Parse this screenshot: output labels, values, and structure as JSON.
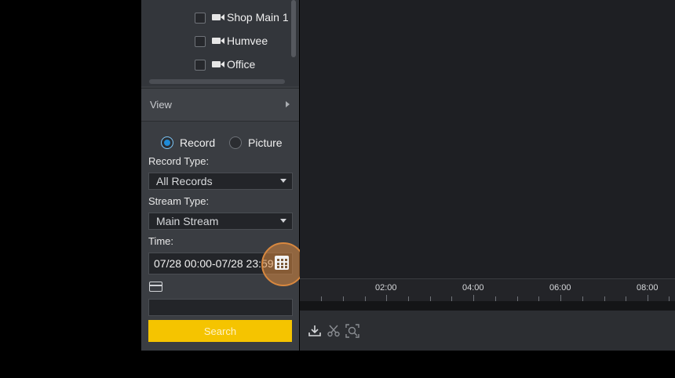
{
  "devices": [
    {
      "label": "Shop Main 1"
    },
    {
      "label": "Humvee"
    },
    {
      "label": "Office"
    }
  ],
  "view": {
    "label": "View"
  },
  "mode": {
    "record_label": "Record",
    "picture_label": "Picture",
    "selected": "Record"
  },
  "record_type": {
    "label": "Record Type:",
    "value": "All Records"
  },
  "stream_type": {
    "label": "Stream Type:",
    "value": "Main Stream"
  },
  "time": {
    "label": "Time:",
    "value": "07/28 00:00-07/28 23:59"
  },
  "card_number": {
    "value": ""
  },
  "search": {
    "label": "Search"
  },
  "timeline": {
    "labels": [
      "02:00",
      "04:00",
      "06:00",
      "08:00"
    ]
  },
  "icons": [
    "camera-icon",
    "chevron-right-icon",
    "calendar-icon",
    "card-icon",
    "download-icon",
    "scissors-icon",
    "capture-icon"
  ],
  "colors": {
    "accent": "#f5c400",
    "highlight": "#d8883f",
    "radio_selected": "#1e8bd8"
  }
}
